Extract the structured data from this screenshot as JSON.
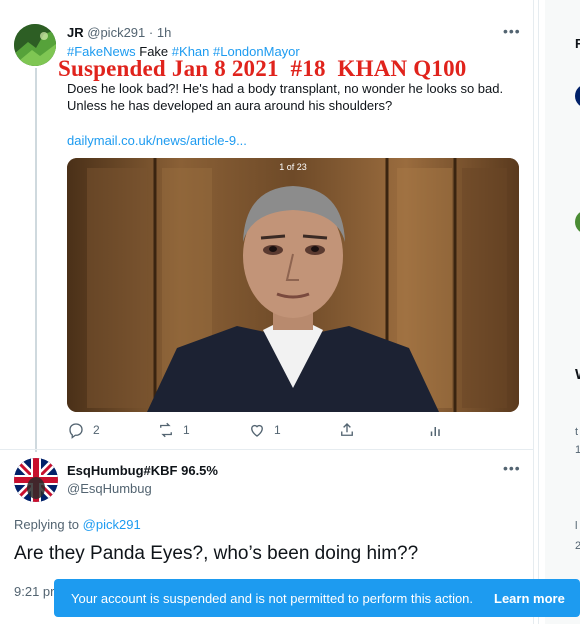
{
  "tweet1": {
    "name": "JR",
    "handle": "@pick291",
    "time": "1h",
    "hashtags": [
      {
        "text": "#FakeNews",
        "type": "tag"
      },
      {
        "text": "Fake",
        "type": "plain"
      },
      {
        "text": "#Khan",
        "type": "tag"
      },
      {
        "text": "#LondonMayor",
        "type": "tag"
      }
    ],
    "overlay_caption": "Suspended Jan 8 2021  #18  KHAN Q100",
    "body_lines": [
      "Does he look bad?!  He's had a body transplant, no wonder he looks so bad.",
      "Unless he has developed an aura around his shoulders?"
    ],
    "link": "dailymail.co.uk/news/article-9...",
    "media_counter": "1 of 23",
    "actions": {
      "replies": "2",
      "retweets": "1",
      "likes": "1"
    }
  },
  "tweet2": {
    "name": "EsqHumbug#KBF 96.5%",
    "handle": "@EsqHumbug",
    "replying_prefix": "Replying to",
    "replying_to": "@pick291",
    "text": "Are they Panda Eyes?, who’s been doing him??",
    "time_partial": "9:21 pr"
  },
  "banner": {
    "message": "Your account is suspended and is not permitted to perform this action.",
    "learn_more": "Learn more"
  },
  "right_column": {
    "fragments": [
      "F",
      "W",
      "t",
      "l",
      "1",
      "2"
    ]
  },
  "colors": {
    "accent": "#1d9bf0",
    "caption_red": "#e0231c",
    "secondary_text": "#536471"
  }
}
